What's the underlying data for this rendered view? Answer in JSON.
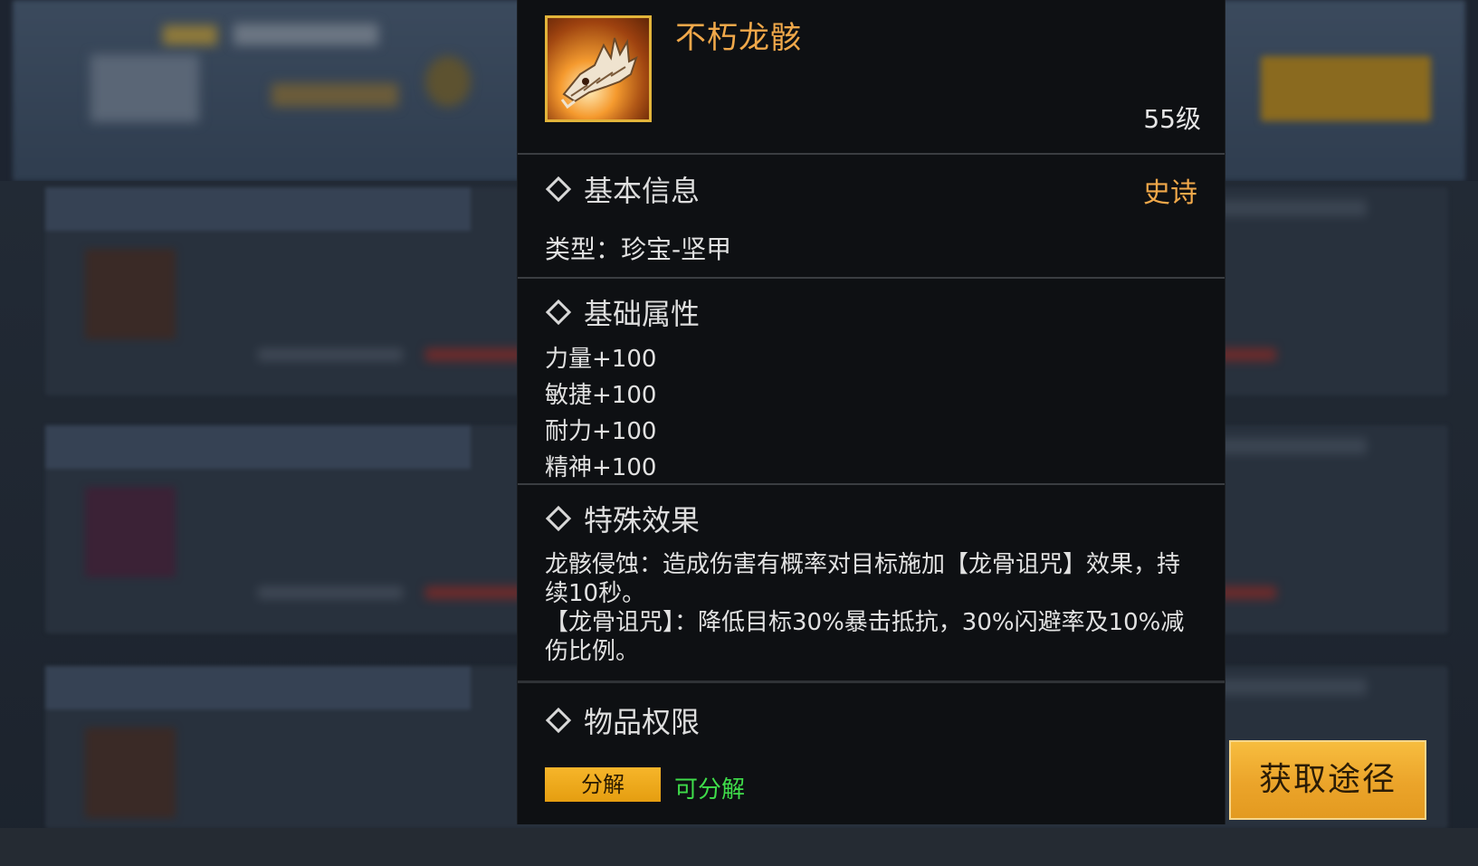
{
  "item": {
    "name": "不朽龙骸",
    "level": "55级",
    "icon": "dragon-skull-icon",
    "name_color": "#f0a84a"
  },
  "basic_info": {
    "title": "基本信息",
    "rarity": "史诗",
    "type_line": "类型：珍宝-坚甲"
  },
  "base_attributes": {
    "title": "基础属性",
    "stats": [
      "力量+100",
      "敏捷+100",
      "耐力+100",
      "精神+100"
    ]
  },
  "special_effect": {
    "title": "特殊效果",
    "lines": [
      "龙骸侵蚀：造成伤害有概率对目标施加【龙骨诅咒】效果，持续10秒。",
      "【龙骨诅咒】：降低目标30%暴击抵抗，30%闪避率及10%减伤比例。"
    ]
  },
  "permissions": {
    "title": "物品权限",
    "button": "分解",
    "status": "可分解",
    "status_color": "#3fdc4a"
  },
  "acquire_button": "获取途径",
  "colors": {
    "accent_gold": "#f0a84a",
    "button_gold": "#eba42a",
    "panel_bg": "#0e1013"
  }
}
